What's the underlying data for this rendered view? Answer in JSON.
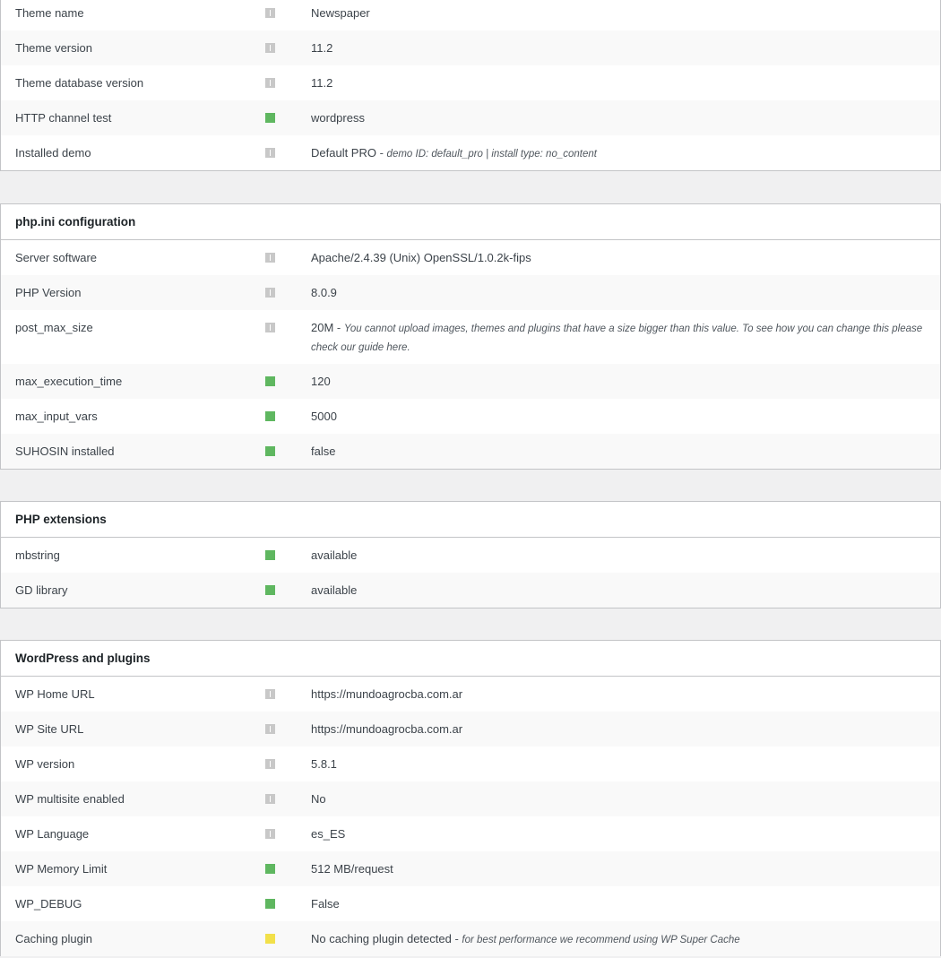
{
  "theme_panel": {
    "rows": [
      {
        "label": "Theme name",
        "status": "info",
        "value": "Newspaper"
      },
      {
        "label": "Theme version",
        "status": "info",
        "value": "11.2"
      },
      {
        "label": "Theme database version",
        "status": "info",
        "value": "11.2"
      },
      {
        "label": "HTTP channel test",
        "status": "ok",
        "value": "wordpress"
      },
      {
        "label": "Installed demo",
        "status": "info",
        "value": "Default PRO",
        "note": "demo ID: default_pro | install type: no_content"
      }
    ]
  },
  "phpini_panel": {
    "title": "php.ini configuration",
    "rows": [
      {
        "label": "Server software",
        "status": "info",
        "value": "Apache/2.4.39 (Unix) OpenSSL/1.0.2k-fips"
      },
      {
        "label": "PHP Version",
        "status": "info",
        "value": "8.0.9"
      },
      {
        "label": "post_max_size",
        "status": "info",
        "value": "20M",
        "note": "You cannot upload images, themes and plugins that have a size bigger than this value. To see how you can change this please check our guide",
        "link": "here"
      },
      {
        "label": "max_execution_time",
        "status": "ok",
        "value": "120"
      },
      {
        "label": "max_input_vars",
        "status": "ok",
        "value": "5000"
      },
      {
        "label": "SUHOSIN installed",
        "status": "ok",
        "value": "false"
      }
    ]
  },
  "extensions_panel": {
    "title": "PHP extensions",
    "rows": [
      {
        "label": "mbstring",
        "status": "ok",
        "value": "available"
      },
      {
        "label": "GD library",
        "status": "ok",
        "value": "available"
      }
    ]
  },
  "wordpress_panel": {
    "title": "WordPress and plugins",
    "rows": [
      {
        "label": "WP Home URL",
        "status": "info",
        "value": "https://mundoagrocba.com.ar"
      },
      {
        "label": "WP Site URL",
        "status": "info",
        "value": "https://mundoagrocba.com.ar"
      },
      {
        "label": "WP version",
        "status": "info",
        "value": "5.8.1"
      },
      {
        "label": "WP multisite enabled",
        "status": "info",
        "value": "No"
      },
      {
        "label": "WP Language",
        "status": "info",
        "value": "es_ES"
      },
      {
        "label": "WP Memory Limit",
        "status": "ok",
        "value": "512 MB/request"
      },
      {
        "label": "WP_DEBUG",
        "status": "ok",
        "value": "False"
      },
      {
        "label": "Caching plugin",
        "status": "warn",
        "value": "No caching plugin detected",
        "note": "for best performance we recommend using",
        "link": "WP Super Cache"
      }
    ]
  },
  "colors": {
    "ok": "#5fb760",
    "info": "#c8c8c8",
    "warn": "#f2e04a",
    "link": "#2271b1"
  }
}
